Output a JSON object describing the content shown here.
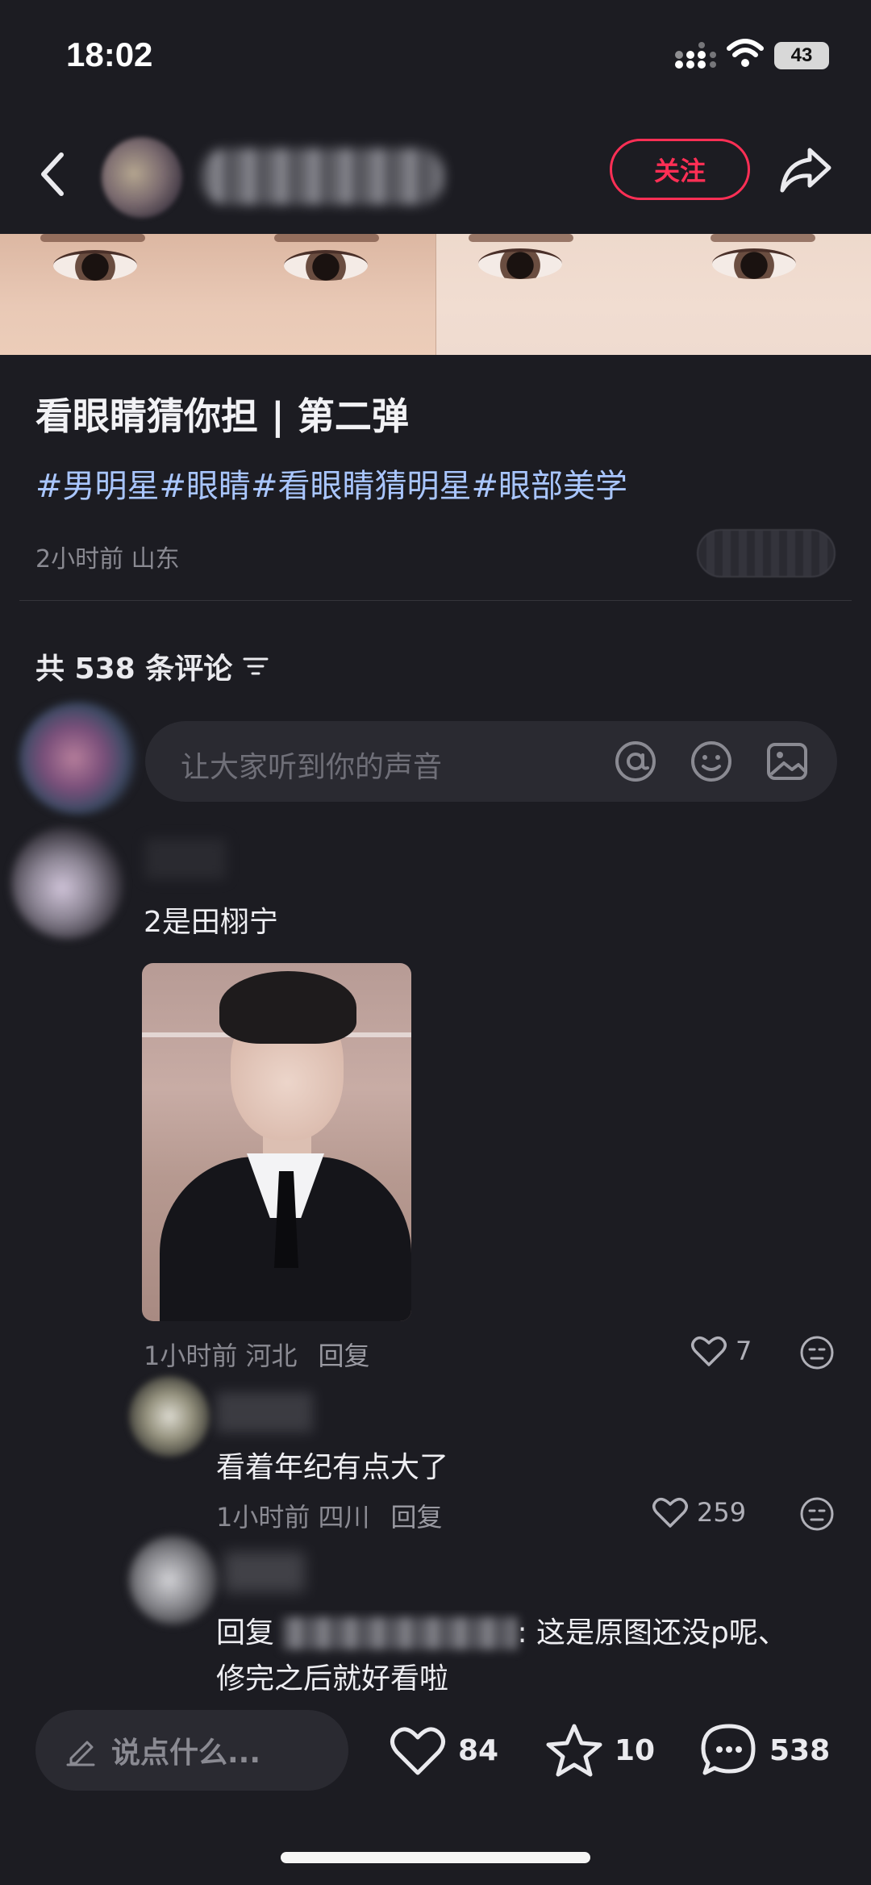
{
  "status": {
    "time": "18:02",
    "battery": "43"
  },
  "nav": {
    "follow_label": "关注"
  },
  "post": {
    "title": "看眼睛猜你担 | 第二弹",
    "hashtags": "#男明星#眼睛#看眼睛猜明星#眼部美学",
    "meta": "2小时前 山东"
  },
  "comments_header": "共 538 条评论",
  "comment_input": {
    "placeholder": "让大家听到你的声音"
  },
  "comments": [
    {
      "text": "2是田栩宁",
      "time_location": "1小时前 河北",
      "reply_label": "回复",
      "likes": "7"
    },
    {
      "text": "看着年纪有点大了",
      "time_location": "1小时前 四川",
      "reply_label": "回复",
      "likes": "259"
    },
    {
      "prefix": "回复",
      "body": ": 这是原图还没p呢、修完之后就好看啦"
    }
  ],
  "bottom_bar": {
    "say_placeholder": "说点什么...",
    "likes": "84",
    "stars": "10",
    "comments": "538"
  },
  "colors": {
    "accent": "#ff2f55",
    "hashtag": "#a9c6ff",
    "background": "#1c1c22"
  }
}
